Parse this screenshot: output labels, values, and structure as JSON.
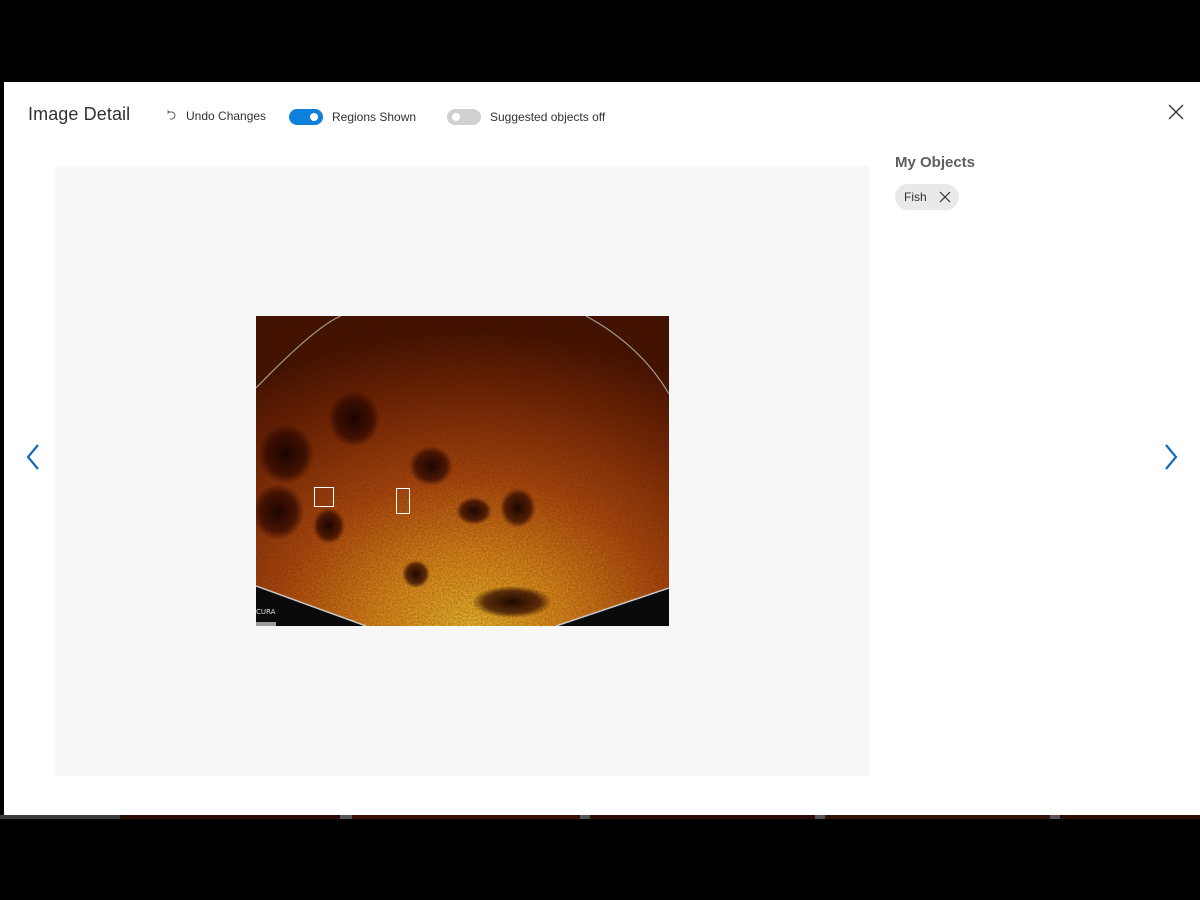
{
  "dialog": {
    "title": "Image Detail",
    "undo_label": "Undo Changes",
    "regions_label": "Regions Shown",
    "regions_on": true,
    "suggested_label": "Suggested objects off",
    "suggested_on": false,
    "accent_color": "#0f7fdc"
  },
  "image": {
    "watermark": "CURA"
  },
  "side_panel": {
    "title": "My Objects",
    "objects": [
      {
        "label": "Fish"
      }
    ]
  },
  "icons": {
    "undo": "undo-icon",
    "close": "close-icon",
    "prev": "chevron-left-icon",
    "next": "chevron-right-icon",
    "remove": "remove-tag-icon"
  }
}
